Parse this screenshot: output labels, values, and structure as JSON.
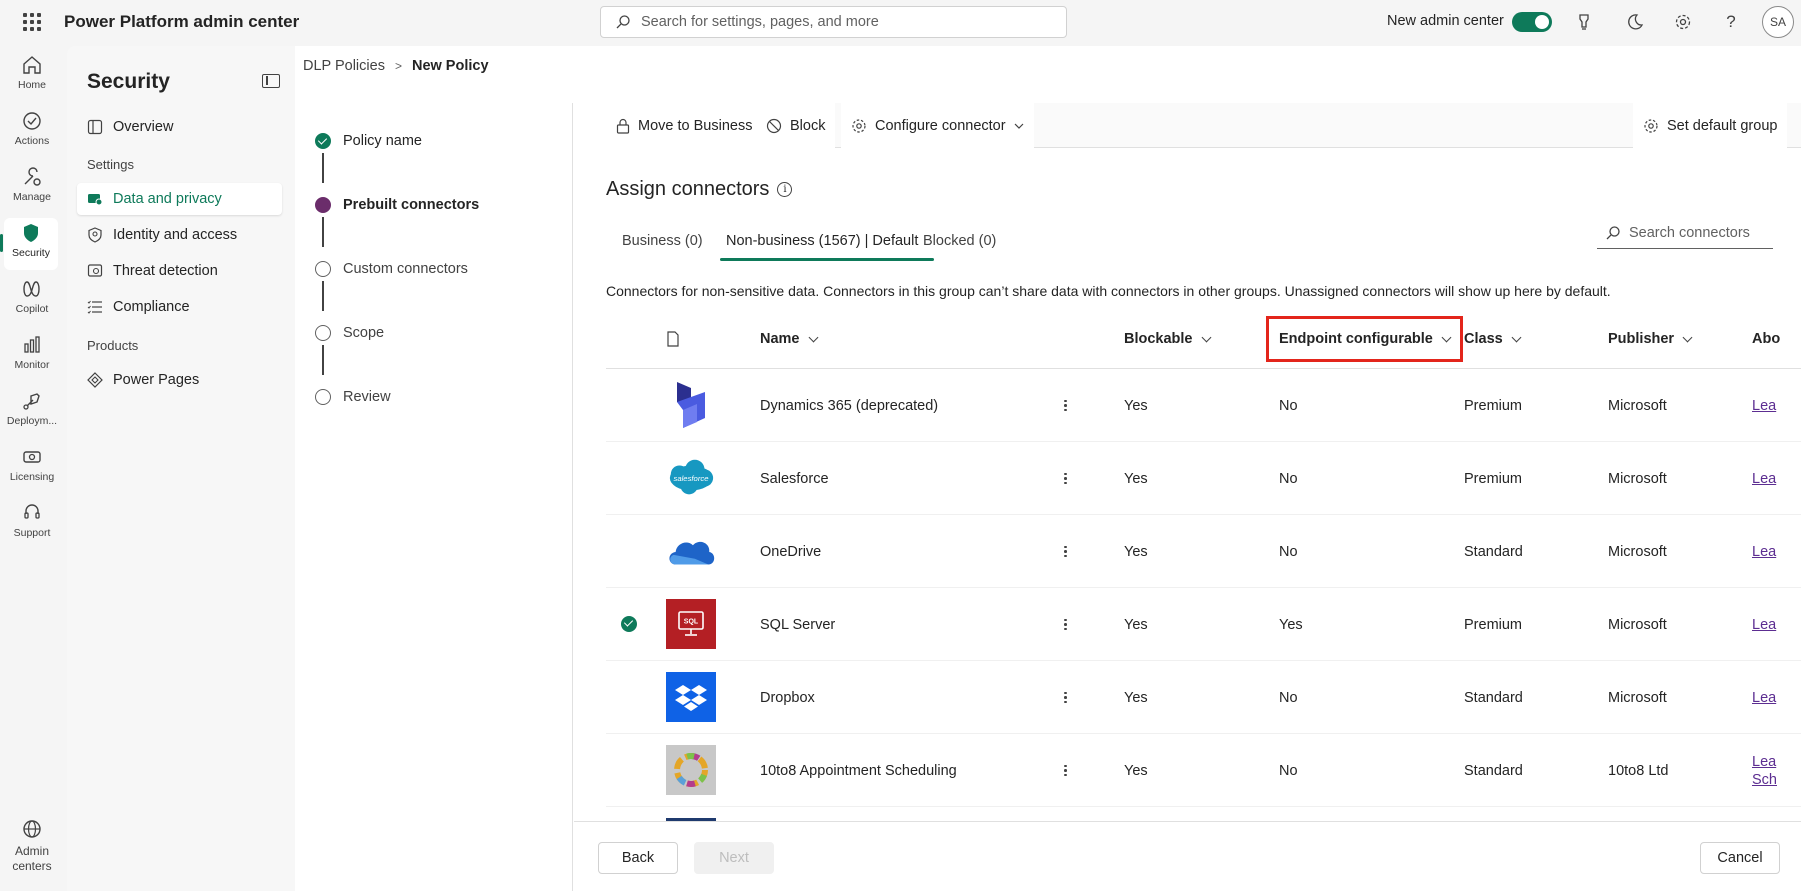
{
  "topbar": {
    "app_title": "Power Platform admin center",
    "search_placeholder": "Search for settings, pages, and more",
    "new_admin_label": "New admin center",
    "new_admin_enabled": true,
    "avatar_initials": "SA",
    "icons": [
      "waffle-icon",
      "search-icon",
      "lightbulb-icon",
      "moon-icon",
      "gear-icon",
      "help-icon"
    ]
  },
  "rail": {
    "items": [
      {
        "label": "Home",
        "icon": "home-icon"
      },
      {
        "label": "Actions",
        "icon": "rocket-icon"
      },
      {
        "label": "Manage",
        "icon": "manage-icon"
      },
      {
        "label": "Security",
        "icon": "shield-icon",
        "active": true
      },
      {
        "label": "Copilot",
        "icon": "copilot-icon"
      },
      {
        "label": "Monitor",
        "icon": "monitor-icon"
      },
      {
        "label": "Deploym...",
        "icon": "deploy-icon"
      },
      {
        "label": "Licensing",
        "icon": "licensing-icon"
      },
      {
        "label": "Support",
        "icon": "support-icon"
      }
    ],
    "admin_centers_line1": "Admin",
    "admin_centers_line2": "centers"
  },
  "secnav": {
    "title": "Security",
    "overview": "Overview",
    "settings_group": "Settings",
    "data_privacy": "Data and privacy",
    "identity_access": "Identity and access",
    "threat_detection": "Threat detection",
    "compliance": "Compliance",
    "products_group": "Products",
    "power_pages": "Power Pages"
  },
  "breadcrumb": {
    "parent": "DLP Policies",
    "separator": ">",
    "current": "New Policy"
  },
  "stepper": {
    "steps": [
      {
        "label": "Policy name",
        "state": "done"
      },
      {
        "label": "Prebuilt connectors",
        "state": "current"
      },
      {
        "label": "Custom connectors",
        "state": "todo"
      },
      {
        "label": "Scope",
        "state": "todo"
      },
      {
        "label": "Review",
        "state": "todo"
      }
    ]
  },
  "cmdbar": {
    "move_to_business": "Move to Business",
    "block": "Block",
    "configure_connector": "Configure connector",
    "set_default_group": "Set default group"
  },
  "assign": {
    "heading": "Assign connectors",
    "tab_business": "Business (0)",
    "tab_nonbusiness": "Non-business (1567) | Default",
    "tab_blocked": "Blocked (0)",
    "search_placeholder": "Search connectors",
    "description": "Connectors for non-sensitive data. Connectors in this group can’t share data with connectors in other groups. Unassigned connectors will show up here by default."
  },
  "table": {
    "columns": {
      "name": "Name",
      "blockable": "Blockable",
      "endpoint": "Endpoint configurable",
      "class": "Class",
      "publisher": "Publisher",
      "about": "Abo"
    },
    "rows": [
      {
        "name": "Dynamics 365 (deprecated)",
        "blockable": "Yes",
        "endpoint": "No",
        "class": "Premium",
        "publisher": "Microsoft",
        "about": "Lea",
        "logo": "dynamics-logo",
        "selected": false
      },
      {
        "name": "Salesforce",
        "blockable": "Yes",
        "endpoint": "No",
        "class": "Premium",
        "publisher": "Microsoft",
        "about": "Lea",
        "logo": "salesforce-logo",
        "selected": false
      },
      {
        "name": "OneDrive",
        "blockable": "Yes",
        "endpoint": "No",
        "class": "Standard",
        "publisher": "Microsoft",
        "about": "Lea",
        "logo": "onedrive-logo",
        "selected": false
      },
      {
        "name": "SQL Server",
        "blockable": "Yes",
        "endpoint": "Yes",
        "class": "Premium",
        "publisher": "Microsoft",
        "about": "Lea",
        "logo": "sql-logo",
        "selected": true
      },
      {
        "name": "Dropbox",
        "blockable": "Yes",
        "endpoint": "No",
        "class": "Standard",
        "publisher": "Microsoft",
        "about": "Lea",
        "logo": "dropbox-logo",
        "selected": false
      },
      {
        "name": "10to8 Appointment Scheduling",
        "blockable": "Yes",
        "endpoint": "No",
        "class": "Standard",
        "publisher": "10to8 Ltd",
        "about": "Lea",
        "about2": "Sch",
        "logo": "10to8-logo",
        "selected": false
      }
    ]
  },
  "footer": {
    "back": "Back",
    "next": "Next",
    "cancel": "Cancel"
  },
  "colors": {
    "accent": "#0e7a5a",
    "current_step": "#6b2d6b",
    "highlight_box": "#e3251b",
    "link": "#5c2d91"
  }
}
